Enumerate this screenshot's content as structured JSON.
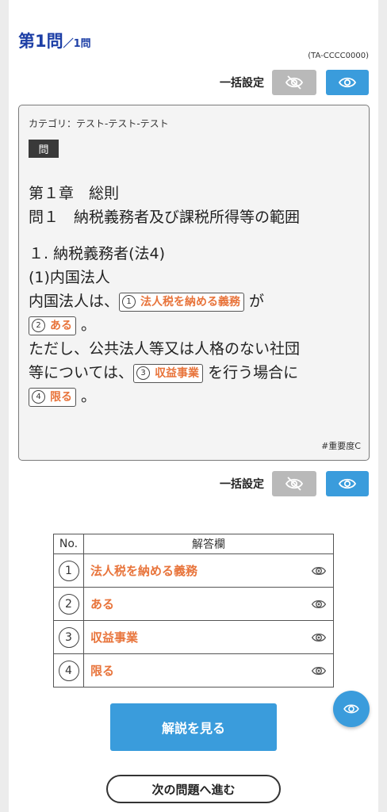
{
  "question": {
    "number": "第1問",
    "total": "／1問",
    "code": "(TA-CCCC0000)",
    "category": "カテゴリ：テスト-テスト-テスト",
    "badge": "問",
    "tag": "#重要度C"
  },
  "bulk": {
    "label": "一括設定"
  },
  "body": {
    "heading1": "第１章　総則",
    "heading2": "問１　納税義務者及び課税所得等の範囲",
    "section": "１. 納税義務者(法4)",
    "subsection": "(1)内国法人",
    "line1_prefix": "内国法人は、",
    "line1_suffix": " が",
    "line2_suffix": " 。",
    "line3": "ただし、公共法人等又は人格のない社団",
    "line4_prefix": "等については、",
    "line4_suffix": " を行う場合に",
    "line5_suffix": " 。"
  },
  "blanks": [
    {
      "num": "1",
      "answer": "法人税を納める義務"
    },
    {
      "num": "2",
      "answer": "ある"
    },
    {
      "num": "3",
      "answer": "収益事業"
    },
    {
      "num": "4",
      "answer": "限る"
    }
  ],
  "table": {
    "col_no": "No.",
    "col_answer": "解答欄",
    "rows": [
      {
        "num": "1",
        "answer": "法人税を納める義務"
      },
      {
        "num": "2",
        "answer": "ある"
      },
      {
        "num": "3",
        "answer": "収益事業"
      },
      {
        "num": "4",
        "answer": "限る"
      }
    ]
  },
  "actions": {
    "explain": "解説を見る",
    "next": "次の問題へ進む"
  },
  "icons": {
    "hide": "eye-off-icon",
    "show": "eye-icon"
  },
  "colors": {
    "accent": "#3a9cdc",
    "answer": "#e8743b",
    "title": "#1d3fa6"
  }
}
